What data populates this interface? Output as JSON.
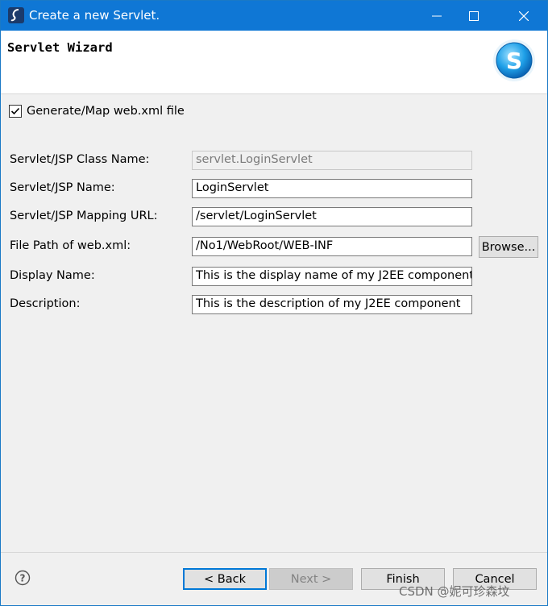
{
  "window": {
    "title": "Create a new Servlet."
  },
  "header": {
    "wizard_title": "Servlet Wizard"
  },
  "checkbox": {
    "label": "Generate/Map web.xml file",
    "checked": true
  },
  "form": {
    "class_name_label": "Servlet/JSP Class Name:",
    "class_name_value": "servlet.LoginServlet",
    "name_label": "Servlet/JSP Name:",
    "name_value": "LoginServlet",
    "mapping_label": "Servlet/JSP Mapping URL:",
    "mapping_value": "/servlet/LoginServlet",
    "file_path_label": "File Path of web.xml:",
    "file_path_value": "/No1/WebRoot/WEB-INF",
    "browse_label": "Browse...",
    "display_name_label": "Display Name:",
    "display_name_value": "This is the display name of my J2EE component",
    "description_label": "Description:",
    "description_value": "This is the description of my J2EE component"
  },
  "footer": {
    "back_label": "< Back",
    "next_label": "Next >",
    "finish_label": "Finish",
    "cancel_label": "Cancel"
  },
  "watermark": "CSDN @妮可珍森坟",
  "colors": {
    "titlebar": "#0f77d5",
    "accent": "#0078d7",
    "dialog_bg": "#f0f0f0"
  }
}
